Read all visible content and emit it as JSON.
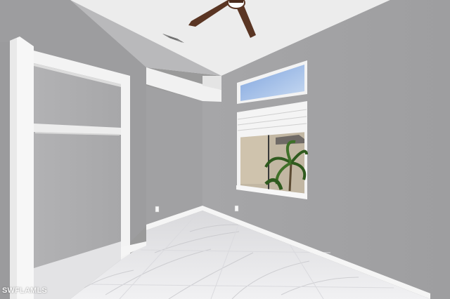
{
  "photo": {
    "watermark": "SWFLAMLS",
    "colors": {
      "wall_right": "#a3a3a5",
      "wall_left": "#9c9c9e",
      "ceiling": "#ececec",
      "trim": "#f4f4f4",
      "floor_marble": "#e6e6e8",
      "window_sky": "#8fb2e6",
      "palm_green": "#2f5a1e"
    }
  }
}
